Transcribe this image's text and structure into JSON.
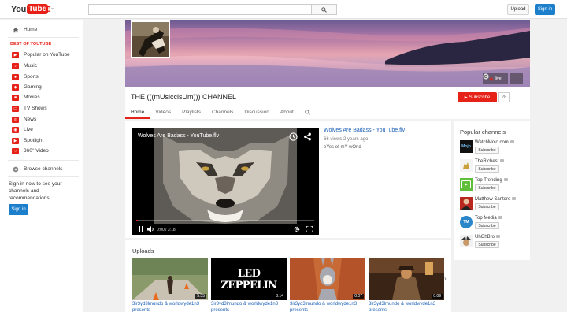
{
  "masthead": {
    "logo_you": "You",
    "logo_tube": "Tube",
    "search_placeholder": "",
    "upload_label": "Upload",
    "signin_label": "Sign in"
  },
  "guide": {
    "items_top": [
      {
        "label": "Home",
        "icon": "home-icon"
      }
    ],
    "section_label": "BEST OF YOUTUBE",
    "items": [
      {
        "label": "Popular on YouTube",
        "icon": "popular-icon"
      },
      {
        "label": "Music",
        "icon": "music-icon"
      },
      {
        "label": "Sports",
        "icon": "sports-icon"
      },
      {
        "label": "Gaming",
        "icon": "gaming-icon"
      },
      {
        "label": "Movies",
        "icon": "movies-icon"
      },
      {
        "label": "TV Shows",
        "icon": "tv-icon"
      },
      {
        "label": "News",
        "icon": "news-icon"
      },
      {
        "label": "Live",
        "icon": "live-icon"
      },
      {
        "label": "Spotlight",
        "icon": "spotlight-icon"
      },
      {
        "label": "360° Video",
        "icon": "360-icon"
      }
    ],
    "browse_label": "Browse channels",
    "signin_note": "Sign in now to see your channels and recommendations!",
    "signin_button": "Sign in"
  },
  "channel": {
    "title": "THE (((mUsiccisUm))) CHANNEL",
    "banner_link_label": "live",
    "subscribe_label": "Subscribe",
    "subscriber_count": "28",
    "tabs": [
      "Home",
      "Videos",
      "Playlists",
      "Channels",
      "Discussion",
      "About"
    ],
    "active_tab": 0
  },
  "featured": {
    "player_title": "Wolves Are Badass - YouTube.flv",
    "time": "0:00 / 3:18",
    "progress": 0.01,
    "title": "Wolves Are Badass - YouTube.flv",
    "meta": "66 views  2 years ago",
    "description": "eYes of mY wOrld"
  },
  "uploads": {
    "title": "Uploads",
    "items": [
      {
        "duration": "5:35",
        "label": "3ir3yd3lmundo & worldwyde1n3 presents"
      },
      {
        "duration": "8:14",
        "label": "3ir3yd3lmundo & worldwyde1n3 presents"
      },
      {
        "duration": "0:07",
        "label": "3ir3yd3lmundo & worldwyde1n3 presents"
      },
      {
        "duration": "0:09",
        "label": "3ir3yd3lmundo & worldwyde1n3 presents"
      }
    ],
    "thumb2_text": "LED ZEPPELIN"
  },
  "popular": {
    "title": "Popular channels",
    "subscribe_label": "Subscribe",
    "channels": [
      {
        "name": "WatchMojo.com",
        "avatar_text": "Mojo"
      },
      {
        "name": "TheRichest",
        "avatar_text": ""
      },
      {
        "name": "Top Trending",
        "avatar_text": ""
      },
      {
        "name": "Matthew Santoro",
        "avatar_text": ""
      },
      {
        "name": "Top Media",
        "avatar_text": "TM"
      },
      {
        "name": "UhOhBro",
        "avatar_text": ""
      }
    ]
  },
  "colors": {
    "brand_red": "#e62117",
    "link_blue": "#1a5fb4",
    "signin_blue": "#1b7fcc"
  }
}
